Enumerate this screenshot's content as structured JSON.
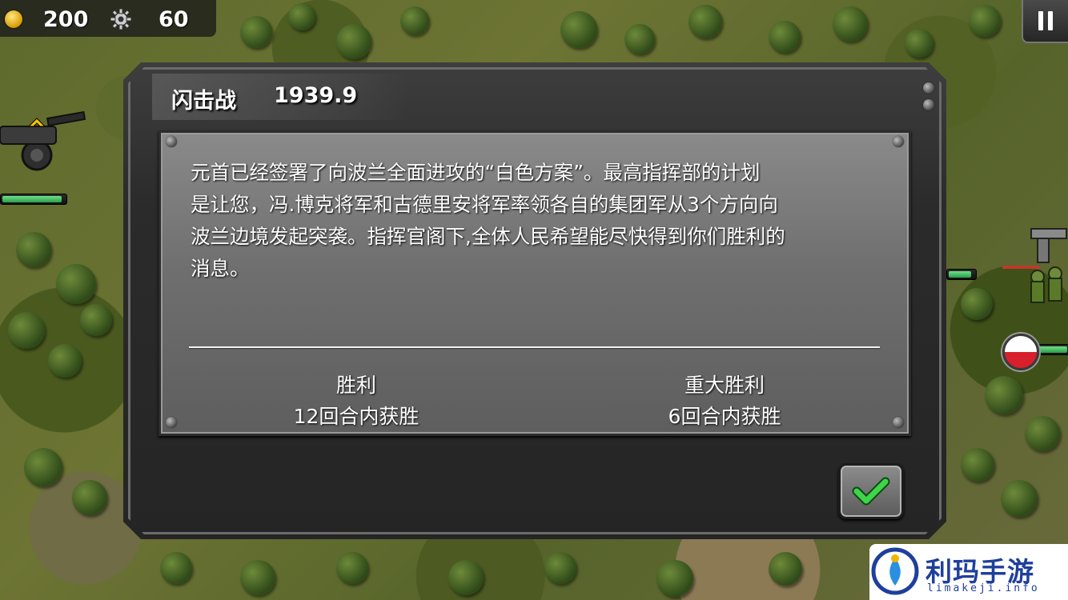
{
  "hud": {
    "gold": "200",
    "industry": "60",
    "gold_icon": "coin-icon",
    "industry_icon": "gear-icon",
    "pause_icon": "pause-icon"
  },
  "dialog": {
    "title": "闪击战",
    "date": "1939.9",
    "briefing_lines": [
      "元首已经签署了向波兰全面进攻的“白色方案”。最高指挥部的计划",
      "是让您，冯.博克将军和古德里安将军率领各自的集团军从3个方向向",
      "波兰边境发起突袭。指挥官阁下,全体人民希望能尽快得到你们胜利的",
      "消息。"
    ],
    "goals": {
      "victory_label": "胜利",
      "victory_condition": "12回合内获胜",
      "major_victory_label": "重大胜利",
      "major_victory_condition": "6回合内获胜"
    },
    "confirm_icon": "checkmark-icon"
  },
  "map": {
    "enemy_flag": "poland-flag-icon"
  },
  "watermark": {
    "name": "利玛手游",
    "domain": "limakeji.info"
  }
}
